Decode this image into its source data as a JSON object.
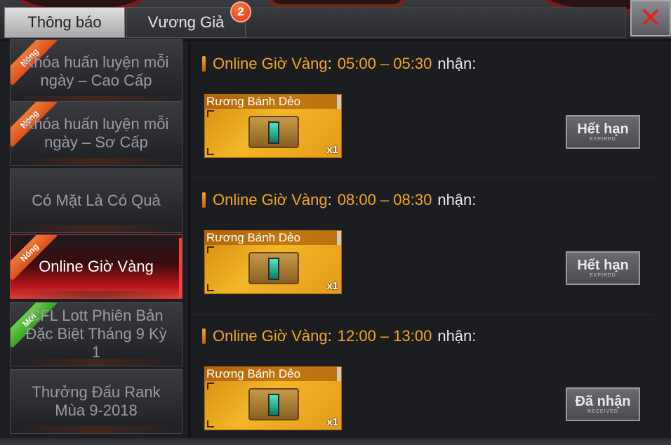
{
  "tabs": [
    {
      "label": "Thông báo",
      "active": true
    },
    {
      "label": "Vương Giả",
      "active": false,
      "badge": "2"
    }
  ],
  "close_label": "✕",
  "sidebar": {
    "items": [
      {
        "label": "Khóa huấn luyện mỗi ngày – Cao Cấp",
        "ribbon": "Nóng",
        "ribbon_type": "hot",
        "active": false
      },
      {
        "label": "Khóa huấn luyện mỗi ngày – Sơ Cấp",
        "ribbon": "Nóng",
        "ribbon_type": "hot",
        "active": false
      },
      {
        "label": "Có Mặt Là Có Quà",
        "ribbon": "",
        "ribbon_type": "",
        "active": false
      },
      {
        "label": "Online Giờ Vàng",
        "ribbon": "Nóng",
        "ribbon_type": "hot",
        "active": true
      },
      {
        "label": "CFL Lott Phiên Bản Đặc Biệt Tháng 9 Kỳ 1",
        "ribbon": "Mới",
        "ribbon_type": "new",
        "active": false
      },
      {
        "label": "Thưởng Đấu Rank Mùa 9-2018",
        "ribbon": "",
        "ribbon_type": "",
        "active": false
      }
    ]
  },
  "entries": [
    {
      "label": "Online Giờ Vàng",
      "time": "05:00 – 05:30",
      "receive": "nhận:",
      "item": {
        "name": "Rương Bánh Dẻo",
        "qty": "x1"
      },
      "status": {
        "main": "Hết hạn",
        "sub": "EXPIRED"
      }
    },
    {
      "label": "Online Giờ Vàng",
      "time": "08:00 – 08:30",
      "receive": "nhận:",
      "item": {
        "name": "Rương Bánh Dẻo",
        "qty": "x1"
      },
      "status": {
        "main": "Hết hạn",
        "sub": "EXPIRED"
      }
    },
    {
      "label": "Online Giờ Vàng",
      "time": "12:00 – 13:00",
      "receive": "nhận:",
      "item": {
        "name": "Rương Bánh Dẻo",
        "qty": "x1"
      },
      "status": {
        "main": "Đã nhận",
        "sub": "RECEIVED"
      }
    }
  ],
  "colors": {
    "accent": "#f5a623",
    "active_tab_red": "#e03030",
    "close_red": "#e02020",
    "badge": "#d8320c"
  }
}
